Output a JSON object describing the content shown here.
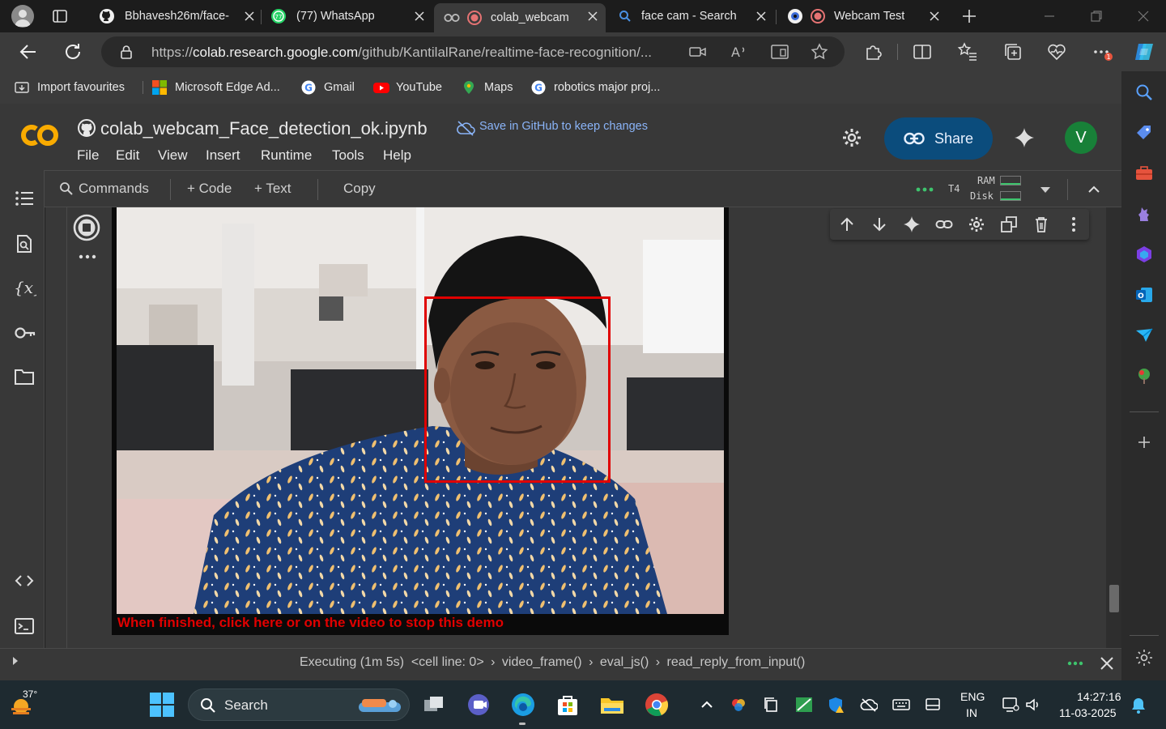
{
  "tabs": [
    {
      "title": "Bbhavesh26m/face-",
      "icon": "github-icon",
      "active": false
    },
    {
      "title": "(77) WhatsApp",
      "icon": "whatsapp-icon",
      "active": false
    },
    {
      "title": "colab_webcam",
      "icon": "colab-icon",
      "active": true,
      "recording": true
    },
    {
      "title": "face cam - Search",
      "icon": "bing-search-icon",
      "active": false
    },
    {
      "title": "Webcam Test",
      "icon": "webcam-test-icon",
      "active": false,
      "recording": true
    }
  ],
  "address_bar": {
    "url_prefix": "https://",
    "url_host": "colab.research.google.com",
    "url_path": "/github/KantilalRane/realtime-face-recognition/..."
  },
  "favourites": [
    {
      "label": "Import favourites",
      "icon": "import-favourites-icon"
    },
    {
      "label": "Microsoft Edge Ad...",
      "icon": "microsoft-icon"
    },
    {
      "label": "Gmail",
      "icon": "google-icon"
    },
    {
      "label": "YouTube",
      "icon": "youtube-icon"
    },
    {
      "label": "Maps",
      "icon": "maps-pin-icon"
    },
    {
      "label": "robotics major proj...",
      "icon": "google-icon"
    }
  ],
  "colab": {
    "logo": "CO",
    "notebook_title": "colab_webcam_Face_detection_ok.ipynb",
    "save_github": "Save in GitHub to keep changes",
    "menus": [
      "File",
      "Edit",
      "View",
      "Insert",
      "Runtime",
      "Tools",
      "Help"
    ],
    "share_label": "Share",
    "avatar_letter": "V",
    "toolbar": {
      "commands": "Commands",
      "code": "+ Code",
      "text": "+ Text",
      "copy": "Copy",
      "runtime_type": "T4",
      "ram_label": "RAM",
      "disk_label": "Disk"
    },
    "output": {
      "stop_message": "When finished, click here or on the video to stop this demo"
    },
    "status": {
      "executing": "Executing (1m 5s)",
      "trace": [
        "<cell line: 0>",
        "video_frame()",
        "eval_js()",
        "read_reply_from_input()"
      ]
    }
  },
  "taskbar": {
    "weather": "37°",
    "search_label": "Search",
    "language": "ENG",
    "region": "IN",
    "time": "14:27:16",
    "date": "11-03-2025"
  },
  "colors": {
    "colab_orange": "#f9ab00",
    "share_bg": "#0b4c7c",
    "detection_box": "#e00000",
    "avatar_bg": "#188038"
  }
}
